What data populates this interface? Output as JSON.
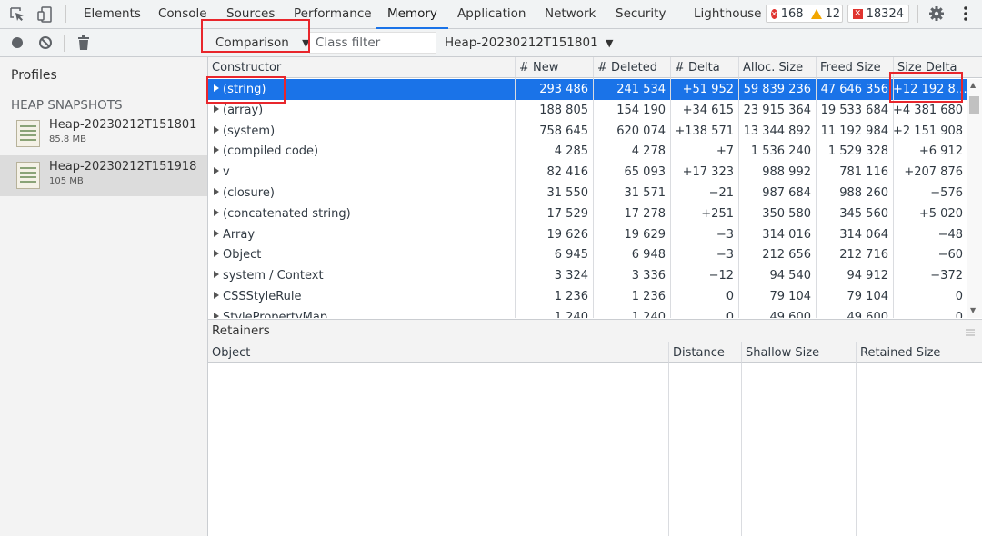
{
  "tabs": {
    "items": [
      {
        "label": "Elements"
      },
      {
        "label": "Console"
      },
      {
        "label": "Sources"
      },
      {
        "label": "Performance"
      },
      {
        "label": "Memory"
      },
      {
        "label": "Application"
      },
      {
        "label": "Network"
      },
      {
        "label": "Security"
      },
      {
        "label": "Lighthouse"
      }
    ],
    "active": "Memory",
    "errors_count": "168",
    "warnings_count": "12",
    "issues_count": "18324"
  },
  "toolbar": {
    "view_mode": "Comparison",
    "class_filter_placeholder": "Class filter",
    "base_snapshot": "Heap-20230212T151801"
  },
  "sidebar": {
    "profiles_label": "Profiles",
    "section_label": "HEAP SNAPSHOTS",
    "snapshots": [
      {
        "name": "Heap-20230212T151801",
        "size": "85.8 MB",
        "selected": false
      },
      {
        "name": "Heap-20230212T151918",
        "size": "105 MB",
        "selected": true
      }
    ]
  },
  "comparison_table": {
    "headers": [
      "Constructor",
      "# New",
      "# Deleted",
      "# Delta",
      "Alloc. Size",
      "Freed Size",
      "Size Delta"
    ],
    "rows": [
      [
        "(string)",
        "293 486",
        "241 534",
        "+51 952",
        "59 839 236",
        "47 646 356",
        "+12 192 8…"
      ],
      [
        "(array)",
        "188 805",
        "154 190",
        "+34 615",
        "23 915 364",
        "19 533 684",
        "+4 381 680"
      ],
      [
        "(system)",
        "758 645",
        "620 074",
        "+138 571",
        "13 344 892",
        "11 192 984",
        "+2 151 908"
      ],
      [
        "(compiled code)",
        "4 285",
        "4 278",
        "+7",
        "1 536 240",
        "1 529 328",
        "+6 912"
      ],
      [
        "v",
        "82 416",
        "65 093",
        "+17 323",
        "988 992",
        "781 116",
        "+207 876"
      ],
      [
        "(closure)",
        "31 550",
        "31 571",
        "−21",
        "987 684",
        "988 260",
        "−576"
      ],
      [
        "(concatenated string)",
        "17 529",
        "17 278",
        "+251",
        "350 580",
        "345 560",
        "+5 020"
      ],
      [
        "Array",
        "19 626",
        "19 629",
        "−3",
        "314 016",
        "314 064",
        "−48"
      ],
      [
        "Object",
        "6 945",
        "6 948",
        "−3",
        "212 656",
        "212 716",
        "−60"
      ],
      [
        "system / Context",
        "3 324",
        "3 336",
        "−12",
        "94 540",
        "94 912",
        "−372"
      ],
      [
        "CSSStyleRule",
        "1 236",
        "1 236",
        "0",
        "79 104",
        "79 104",
        "0"
      ],
      [
        "StylePropertyMap",
        "1 240",
        "1 240",
        "0",
        "49 600",
        "49 600",
        "0"
      ]
    ],
    "selected_row": 0
  },
  "retainers": {
    "title": "Retainers",
    "headers": [
      "Object",
      "Distance",
      "Shallow Size",
      "Retained Size"
    ]
  },
  "colors": {
    "accent": "#1a73e8",
    "highlight_box": "#e8262c",
    "error": "#e0342f",
    "warning": "#f2a600"
  }
}
